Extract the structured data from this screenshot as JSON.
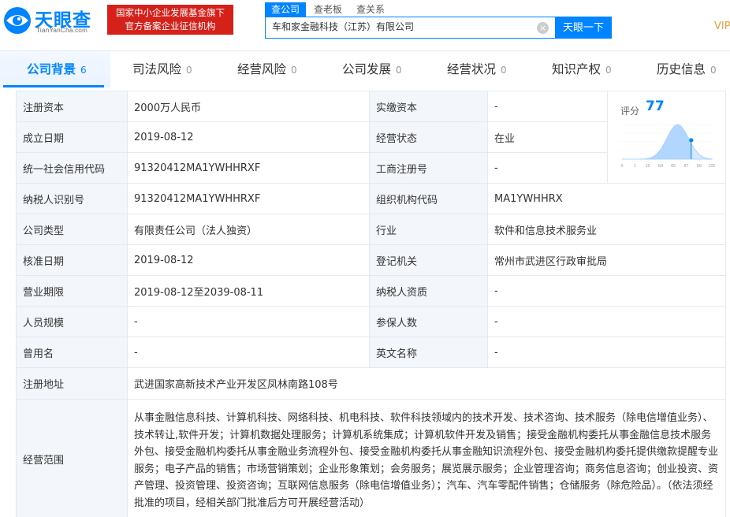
{
  "header": {
    "logo_text": "天眼查",
    "logo_sub": "TianYanCha.com",
    "gov_badge_line1": "国家中小企业发展基金旗下",
    "gov_badge_line2": "官方备案企业征信机构",
    "search_tabs": [
      "查公司",
      "查老板",
      "查关系"
    ],
    "search_value": "车和家金融科技（江苏）有限公司",
    "search_button": "天眼一下",
    "vip": "VIP"
  },
  "nav": {
    "tabs": [
      {
        "label": "公司背景",
        "count": "6"
      },
      {
        "label": "司法风险",
        "count": "0"
      },
      {
        "label": "经营风险",
        "count": "0"
      },
      {
        "label": "公司发展",
        "count": "0"
      },
      {
        "label": "经营状况",
        "count": "0"
      },
      {
        "label": "知识产权",
        "count": "0"
      },
      {
        "label": "历史信息",
        "count": "0"
      }
    ]
  },
  "score": {
    "label": "评分",
    "value": "77",
    "value_num": 77,
    "axis": [
      "0",
      "1",
      "15",
      "50",
      "65",
      "87",
      "99",
      "100"
    ],
    "accent": "#0084ff"
  },
  "info": {
    "reg_capital_label": "注册资本",
    "reg_capital": "2000万人民币",
    "paid_capital_label": "实缴资本",
    "paid_capital": "-",
    "est_date_label": "成立日期",
    "est_date": "2019-08-12",
    "status_label": "经营状态",
    "status": "在业",
    "credit_code_label": "统一社会信用代码",
    "credit_code": "91320412MA1YWHHRXF",
    "biz_reg_no_label": "工商注册号",
    "biz_reg_no": "-",
    "taxpayer_id_label": "纳税人识别号",
    "taxpayer_id": "91320412MA1YWHHRXF",
    "org_code_label": "组织机构代码",
    "org_code": "MA1YWHHRX",
    "company_type_label": "公司类型",
    "company_type": "有限责任公司（法人独资）",
    "industry_label": "行业",
    "industry": "软件和信息技术服务业",
    "approval_date_label": "核准日期",
    "approval_date": "2019-08-12",
    "authority_label": "登记机关",
    "authority": "常州市武进区行政审批局",
    "term_label": "营业期限",
    "term": "2019-08-12至2039-08-11",
    "taxpayer_qual_label": "纳税人资质",
    "taxpayer_qual": "-",
    "staff_size_label": "人员规模",
    "staff_size": "-",
    "insured_label": "参保人数",
    "insured": "-",
    "former_name_label": "曾用名",
    "former_name": "-",
    "english_name_label": "英文名称",
    "english_name": "-",
    "address_label": "注册地址",
    "address": "武进国家高新技术产业开发区凤林南路108号",
    "scope_label": "经营范围",
    "scope": "从事金融信息科技、计算机科技、网络科技、机电科技、软件科技领域内的技术开发、技术咨询、技术服务（除电信增值业务）、技术转让,软件开发；计算机数据处理服务；计算机系统集成；计算机软件开发及销售；接受金融机构委托从事金融信息技术服务外包、接受金融机构委托从事金融业务流程外包、接受金融机构委托从事金融知识流程外包、接受金融机构委托提供缴款提醒专业服务；电子产品的销售；市场营销策划；企业形象策划；会务服务；展览展示服务；企业管理咨询；商务信息咨询；创业投资、资产管理、投资管理、投资咨询；互联网信息服务（除电信增值业务）；汽车、汽车零配件销售；仓储服务（除危险品）。（依法须经批准的项目，经相关部门批准后方可开展经营活动）"
  }
}
